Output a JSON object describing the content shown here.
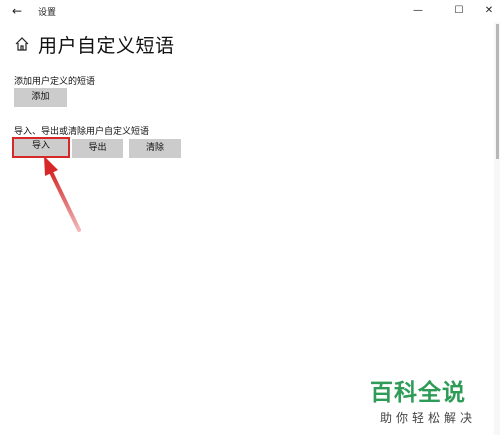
{
  "window": {
    "title": "设置",
    "back_glyph": "←",
    "minimize_glyph": "—",
    "maximize_glyph": "☐",
    "close_glyph": "✕"
  },
  "page": {
    "title": "用户自定义短语"
  },
  "add_section": {
    "label": "添加用户定义的短语",
    "add_button": "添加"
  },
  "manage_section": {
    "label": "导入、导出或清除用户自定义短语",
    "import_button": "导入",
    "export_button": "导出",
    "clear_button": "清除"
  },
  "annotation": {
    "color": "#d62828",
    "icon": "red-arrow-icon"
  },
  "watermark": {
    "brand": "百科全说",
    "slogan": "助你轻松解决",
    "color": "#2e9c57"
  }
}
